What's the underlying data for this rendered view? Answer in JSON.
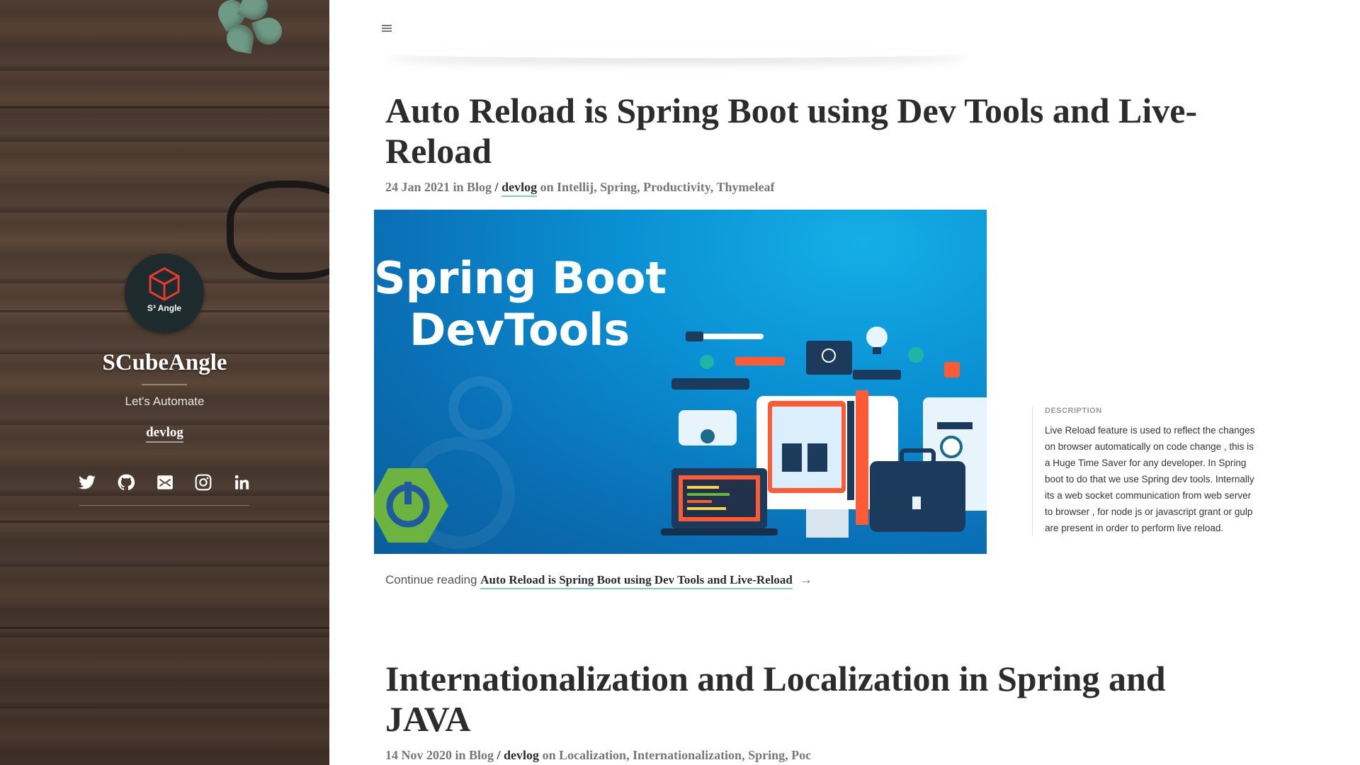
{
  "sidebar": {
    "logo_text": "S³ Angle",
    "site_title": "SCubeAngle",
    "tagline": "Let's Automate",
    "nav_link": "devlog",
    "social": [
      "twitter-icon",
      "github-icon",
      "email-icon",
      "instagram-icon",
      "linkedin-icon"
    ]
  },
  "posts": [
    {
      "title": "Auto Reload is Spring Boot using Dev Tools and Live-Reload",
      "date": "24 Jan 2021",
      "in_text": "in",
      "category": "Blog",
      "sep": "/",
      "section": "devlog",
      "on_text": "on",
      "tags": "Intellij, Spring, Productivity, Thymeleaf",
      "image_line1": "Spring Boot",
      "image_line2": "DevTools",
      "description_label": "DESCRIPTION",
      "description": "Live Reload feature is used to reflect the changes on browser automatically on code change , this is a Huge Time Saver for any developer. In Spring boot to do that we use Spring dev tools. Internally its a web socket communication from web server to browser , for node js or javascript grant or gulp are present in order to perform live reload.",
      "continue_prefix": "Continue reading",
      "continue_link": "Auto Reload is Spring Boot using Dev Tools and Live-Reload",
      "continue_arrow": "→"
    },
    {
      "title": "Internationalization and Localization in Spring and JAVA",
      "date": "14 Nov 2020",
      "in_text": "in",
      "category": "Blog",
      "sep": "/",
      "section": "devlog",
      "on_text": "on",
      "tags": "Localization, Internationalization, Spring, Poc"
    }
  ],
  "colors": {
    "accent_underline": "#86c8c0",
    "title_text": "#2c2c2c",
    "hero_blue": "#0a90d4",
    "spring_green": "#6db33f"
  }
}
